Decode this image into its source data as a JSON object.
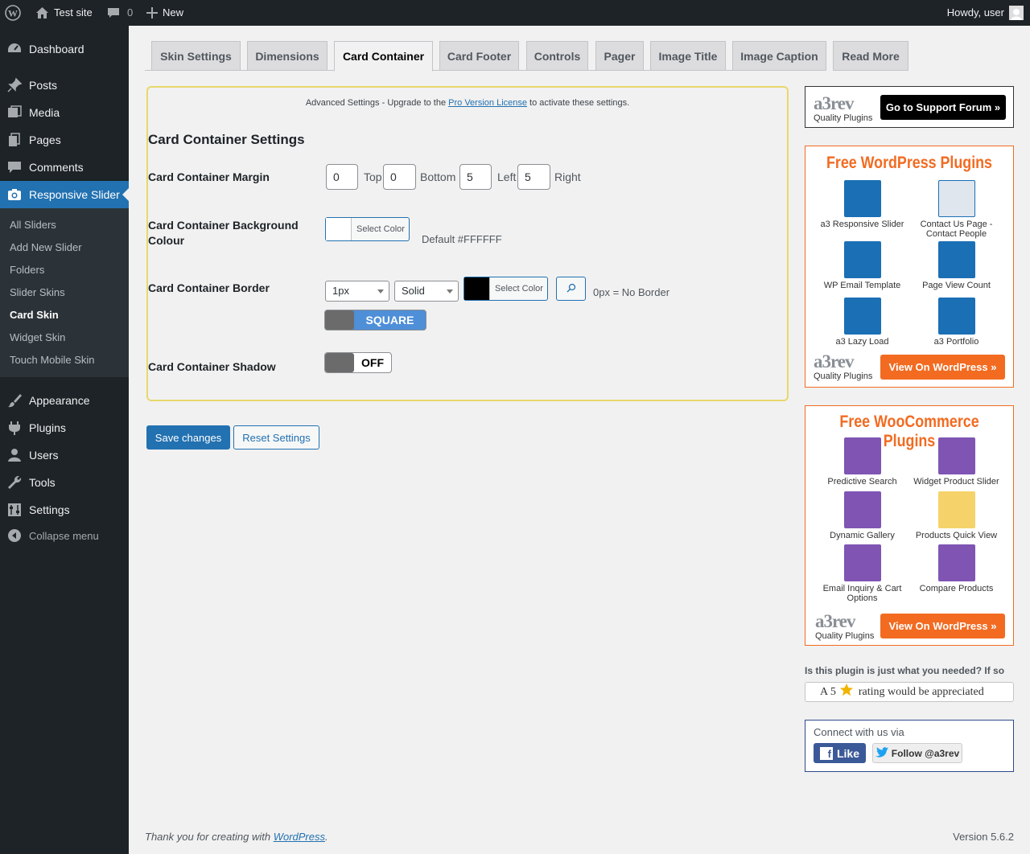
{
  "adminbar": {
    "site_name": "Test site",
    "comments_count": "0",
    "new_label": "New",
    "howdy": "Howdy, user"
  },
  "sidebar": {
    "items": [
      {
        "label": "Dashboard",
        "icon": "dashboard-icon"
      },
      {
        "label": "Posts",
        "icon": "pin-icon"
      },
      {
        "label": "Media",
        "icon": "media-icon"
      },
      {
        "label": "Pages",
        "icon": "pages-icon"
      },
      {
        "label": "Comments",
        "icon": "comment-icon"
      },
      {
        "label": "Responsive Slider",
        "icon": "camera-icon"
      },
      {
        "label": "Appearance",
        "icon": "brush-icon"
      },
      {
        "label": "Plugins",
        "icon": "plug-icon"
      },
      {
        "label": "Users",
        "icon": "user-icon"
      },
      {
        "label": "Tools",
        "icon": "wrench-icon"
      },
      {
        "label": "Settings",
        "icon": "settings-icon"
      },
      {
        "label": "Collapse menu",
        "icon": "collapse-icon"
      }
    ],
    "submenu": [
      "All Sliders",
      "Add New Slider",
      "Folders",
      "Slider Skins",
      "Card Skin",
      "Widget Skin",
      "Touch Mobile Skin"
    ],
    "active_color": "#2271b1"
  },
  "tabs": [
    "Skin Settings",
    "Dimensions",
    "Card Container",
    "Card Footer",
    "Controls",
    "Pager",
    "Image Title",
    "Image Caption",
    "Read More"
  ],
  "panel": {
    "notice_before": "Advanced Settings - Upgrade to the ",
    "notice_link": "Pro Version License",
    "notice_after": " to activate these settings.",
    "section_title": "Card Container Settings",
    "margin_label": "Card Container Margin",
    "margin": [
      {
        "value": "0",
        "unit": "Top"
      },
      {
        "value": "0",
        "unit": "Bottom"
      },
      {
        "value": "5",
        "unit": "Left"
      },
      {
        "value": "5",
        "unit": "Right"
      }
    ],
    "bg_label": "Card Container Background Colour",
    "bg_color_btn": "Select Color",
    "bg_default": "Default #FFFFFF",
    "border_label": "Card Container Border",
    "border_width": "1px",
    "border_style": "Solid",
    "border_color_btn": "Select Color",
    "border_hint": "0px = No Border",
    "border_corner": "SQUARE",
    "shadow_label": "Card Container Shadow",
    "shadow_state": "OFF",
    "highlight_color": "#e8d86b"
  },
  "actions": {
    "save": "Save changes",
    "reset": "Reset Settings"
  },
  "support": {
    "logo_big": "a3rev",
    "logo_small": "Quality Plugins",
    "button": "Go to Support Forum »"
  },
  "wp_plugins": {
    "title": "Free WordPress Plugins",
    "items": [
      "a3 Responsive Slider",
      "Contact Us Page - Contact People",
      "WP Email Template",
      "Page View Count",
      "a3 Lazy Load",
      "a3 Portfolio"
    ],
    "button": "View On WordPress »",
    "accent": "#f26b21"
  },
  "woo_plugins": {
    "title": "Free WooCommerce Plugins",
    "items": [
      "Predictive Search",
      "Widget Product Slider",
      "Dynamic Gallery",
      "Products Quick View",
      "Email Inquiry & Cart Options",
      "Compare Products"
    ],
    "button": "View On WordPress »"
  },
  "rating": {
    "question": "Is this plugin is just what you needed? If so",
    "before": "A 5",
    "after": "rating would be appreciated"
  },
  "connect": {
    "title": "Connect with us via",
    "like": "Like",
    "follow": "Follow @a3rev"
  },
  "footer": {
    "thanks_before": "Thank you for creating with ",
    "thanks_link": "WordPress",
    "thanks_after": ".",
    "version": "Version 5.6.2"
  }
}
